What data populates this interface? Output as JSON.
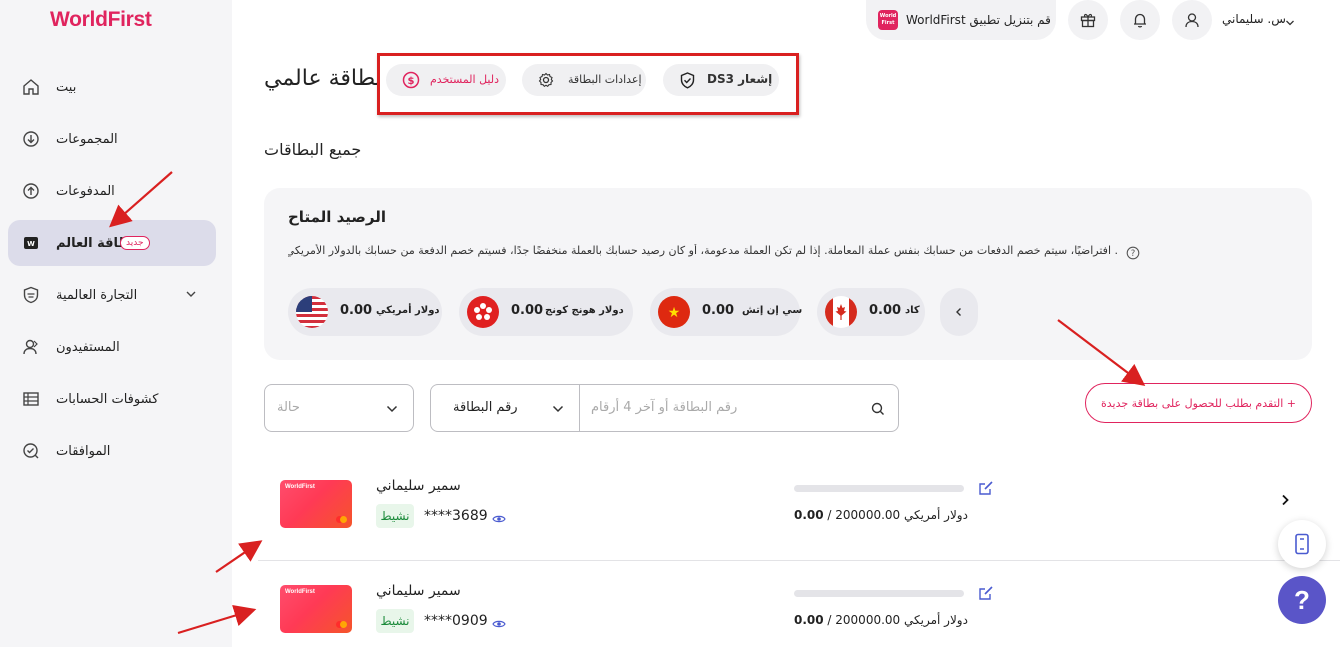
{
  "brand": {
    "logo": "WorldFirst",
    "accent": "#e0245e"
  },
  "sidebar": {
    "items": [
      {
        "label": "بيت",
        "icon": "home-icon"
      },
      {
        "label": "المجموعات",
        "icon": "collection-icon"
      },
      {
        "label": "المدفوعات",
        "icon": "payment-icon"
      },
      {
        "label": "بطاقة العالم",
        "icon": "world-card-icon",
        "badge": "جديد",
        "active": true
      },
      {
        "label": "التجارة العالمية",
        "icon": "shield-globe-icon"
      },
      {
        "label": "المستفيدون",
        "icon": "beneficiary-icon"
      },
      {
        "label": "كشوفات الحسابات",
        "icon": "statement-icon"
      },
      {
        "label": "الموافقات",
        "icon": "approval-icon"
      }
    ]
  },
  "topbar": {
    "app_download": "WorldFirst قم بتنزيل تطبيق",
    "app_icon_text": "World First",
    "user_name": "س. سليماني"
  },
  "page": {
    "title": "بطاقة عالمي",
    "tabs": [
      {
        "label": "دليل المستخدم",
        "icon": "dollar-circle-icon"
      },
      {
        "label": "إعدادات البطاقة",
        "icon": "settings-icon"
      },
      {
        "label": "DSإشعار 3",
        "icon": "shield-check-icon"
      }
    ],
    "section_title": "جميع البطاقات"
  },
  "balance": {
    "title": "الرصيد المتاح",
    "info": ". افتراضيًا، سيتم خصم الدفعات من حسابك بنفس عملة المعاملة. إذا لم تكن العملة مدعومة، أو كان رصيد حسابك بالعملة منخفضًا جدًا، فسيتم خصم الدفعة من حسابك بالدولار الأمريكي",
    "currencies": [
      {
        "name": "دولار أمريكي",
        "amount": "0.00",
        "flag": "us-flag-icon"
      },
      {
        "name": "دولار هونج كونج",
        "amount": "0.00",
        "flag": "hk-flag-icon"
      },
      {
        "name": "سي إن إتش",
        "amount": "0.00",
        "flag": "cn-flag-icon"
      },
      {
        "name": "كاد",
        "amount": "0.00",
        "flag": "ca-flag-icon"
      }
    ]
  },
  "filters": {
    "status_placeholder": "حالة",
    "search_type": "رقم البطاقة",
    "search_placeholder": "رقم البطاقة أو آخر 4 أرقام",
    "apply_button": "التقدم بطلب للحصول على بطاقة جديدة  +"
  },
  "cards": [
    {
      "holder": "سمير سليماني",
      "masked": "****3689",
      "status": "نشيط",
      "limit_text": "دولار أمريكي 200000.00 / ",
      "spent": "0.00",
      "used_fraction": 0,
      "card_brand": "WorldFirst"
    },
    {
      "holder": "سمير سليماني",
      "masked": "****0909",
      "status": "نشيط",
      "limit_text": "دولار أمريكي 200000.00 / ",
      "spent": "0.00",
      "used_fraction": 0,
      "card_brand": "WorldFirst"
    }
  ],
  "help": {
    "label": "?"
  }
}
